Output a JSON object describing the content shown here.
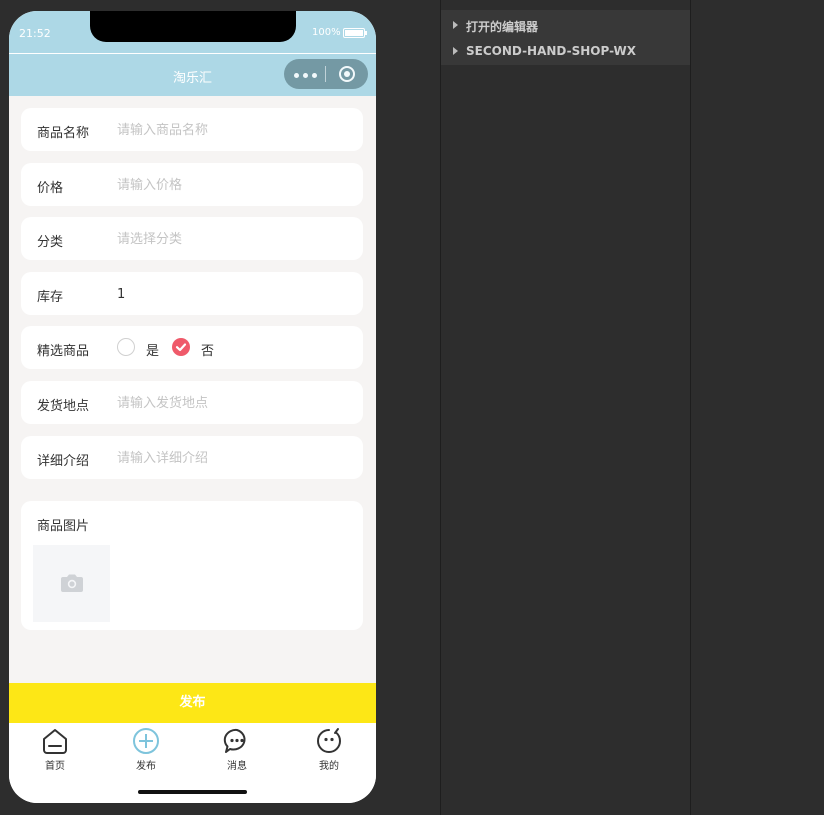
{
  "status_bar": {
    "time": "21:52",
    "battery": "100%"
  },
  "nav": {
    "title": "淘乐汇"
  },
  "form": {
    "name": {
      "label": "商品名称",
      "placeholder": "请输入商品名称"
    },
    "price": {
      "label": "价格",
      "placeholder": "请输入价格"
    },
    "category": {
      "label": "分类",
      "placeholder": "请选择分类"
    },
    "stock": {
      "label": "库存",
      "value": "1"
    },
    "featured": {
      "label": "精选商品",
      "yes": "是",
      "no": "否",
      "selected": "否"
    },
    "location": {
      "label": "发货地点",
      "placeholder": "请输入发货地点"
    },
    "detail": {
      "label": "详细介绍",
      "placeholder": "请输入详细介绍"
    },
    "images": {
      "label": "商品图片",
      "upload_icon": "camera-icon"
    }
  },
  "publish_button": {
    "label": "发布",
    "color": "#fde716"
  },
  "tabbar": {
    "items": [
      {
        "label": "首页",
        "icon": "home-icon"
      },
      {
        "label": "发布",
        "icon": "plus-circle-icon",
        "active": true
      },
      {
        "label": "消息",
        "icon": "message-icon"
      },
      {
        "label": "我的",
        "icon": "profile-icon"
      }
    ]
  },
  "explorer": {
    "sections": [
      {
        "label": "打开的编辑器"
      },
      {
        "label": "SECOND-HAND-SHOP-WX"
      }
    ]
  },
  "colors": {
    "header": "#add8e6",
    "checked": "#ef5a6a",
    "background": "#f6f4f3"
  }
}
